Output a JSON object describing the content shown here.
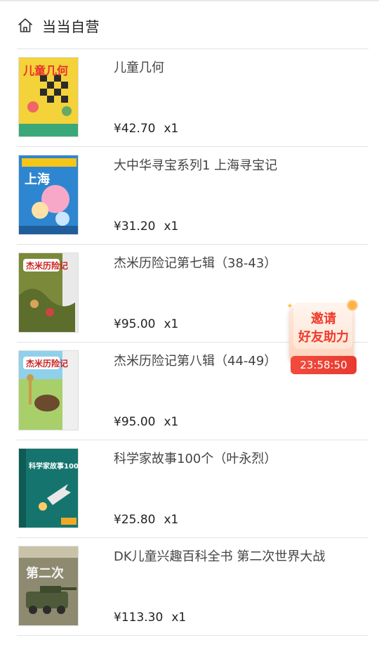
{
  "store": {
    "name": "当当自营",
    "icon": "home-icon"
  },
  "items": [
    {
      "title": "儿童几何",
      "price": "¥42.70",
      "qty": "x1",
      "cover_text": "儿童几何"
    },
    {
      "title": "大中华寻宝系列1 上海寻宝记",
      "price": "¥31.20",
      "qty": "x1",
      "cover_text": "上海"
    },
    {
      "title": "杰米历险记第七辑（38-43）",
      "price": "¥95.00",
      "qty": "x1",
      "cover_text": "杰米历险记"
    },
    {
      "title": "杰米历险记第八辑（44-49）",
      "price": "¥95.00",
      "qty": "x1",
      "cover_text": "杰米历险记"
    },
    {
      "title": "科学家故事100个（叶永烈）",
      "price": "¥25.80",
      "qty": "x1",
      "cover_text": "科学家故事100个"
    },
    {
      "title": "DK儿童兴趣百科全书 第二次世界大战",
      "price": "¥113.30",
      "qty": "x1",
      "cover_text": "第二次"
    }
  ],
  "invite_badge": {
    "line1": "邀请",
    "line2": "好友助力",
    "timer": "23:58:50"
  },
  "colors": {
    "badge_red": "#ef3b2d",
    "separator": "#e2e2e2"
  }
}
